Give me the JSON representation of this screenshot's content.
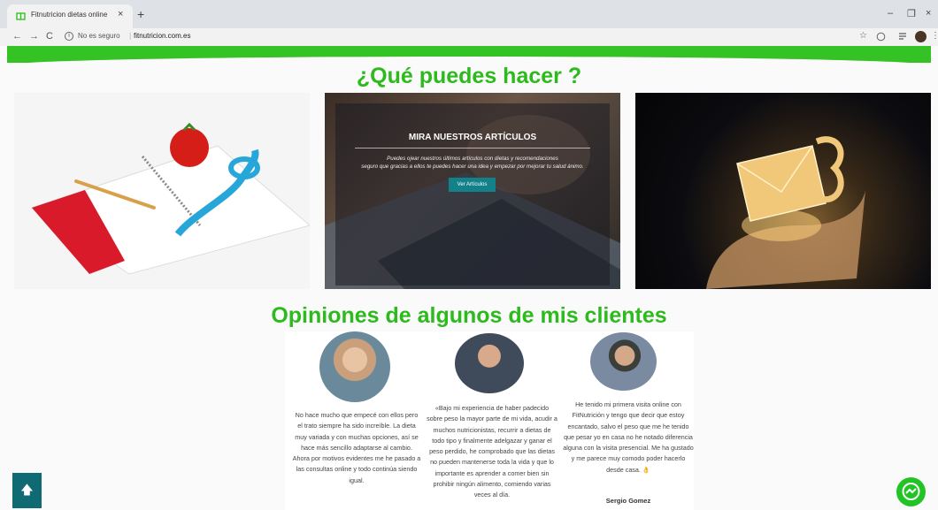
{
  "browser": {
    "tab_title": "Fitnutricion dietas online",
    "tab_close": "×",
    "new_tab": "+",
    "not_secure": "No es seguro",
    "url": "fitnutricion.com.es",
    "back": "←",
    "forward": "→",
    "reload": "C",
    "minimize": "–",
    "restore": "❐",
    "close": "×",
    "star_icon": "☆",
    "menu": "⋮"
  },
  "colors": {
    "brand_green": "#35c225",
    "heading_green": "#2cba1c",
    "button_teal": "#12818a",
    "back_top_bg": "#0f6a73"
  },
  "main": {
    "heading": "¿Qué puedes hacer ?",
    "cards": [
      {
        "name": "nutrition-notebook-image"
      },
      {
        "name": "articles-card",
        "title": "MIRA NUESTROS ARTÍCULOS",
        "text_line1": "Puedes ojear nuestros últimos artículos con dietas y recomendaciones",
        "text_line2": "seguro que gracias a ellos te puedes hacer una idea y empezar por mejorar tu salud ánimo.",
        "button": "Ver Artículos"
      },
      {
        "name": "contact-envelope-image"
      }
    ]
  },
  "reviews": {
    "heading": "Opiniones de algunos de mis clientes",
    "items": [
      {
        "text": "No hace mucho que empecé con ellos pero el trato siempre ha sido increíble. La dieta muy variada y con muchas opciones, así se hace más sencillo adaptarse al cambio. Ahora por motivos evidentes me he pasado a las consultas online y todo continúa siendo igual."
      },
      {
        "text": "«Bajo mi experiencia de haber padecido sobre peso la mayor parte de mi vida, acudir a muchos nutricionistas, recurrir a dietas de todo tipo y finalmente adelgazar y ganar el peso perdido, he comprobado que las dietas no pueden mantenerse toda la vida y que lo importante es aprender a comer bien sin prohibir ningún alimento, comiendo varias veces al día."
      },
      {
        "text": "He tenido mi primera visita online con FitNutrición y tengo que decir que estoy encantado, salvo el peso que me he tenido que pesar yo en casa no he notado diferencia alguna con la visita presencial. Me ha gustado y me parece muy comodo poder hacerlo desde casa. 👌",
        "name": "Sergio Gomez"
      }
    ]
  },
  "back_to_top": "🡅"
}
